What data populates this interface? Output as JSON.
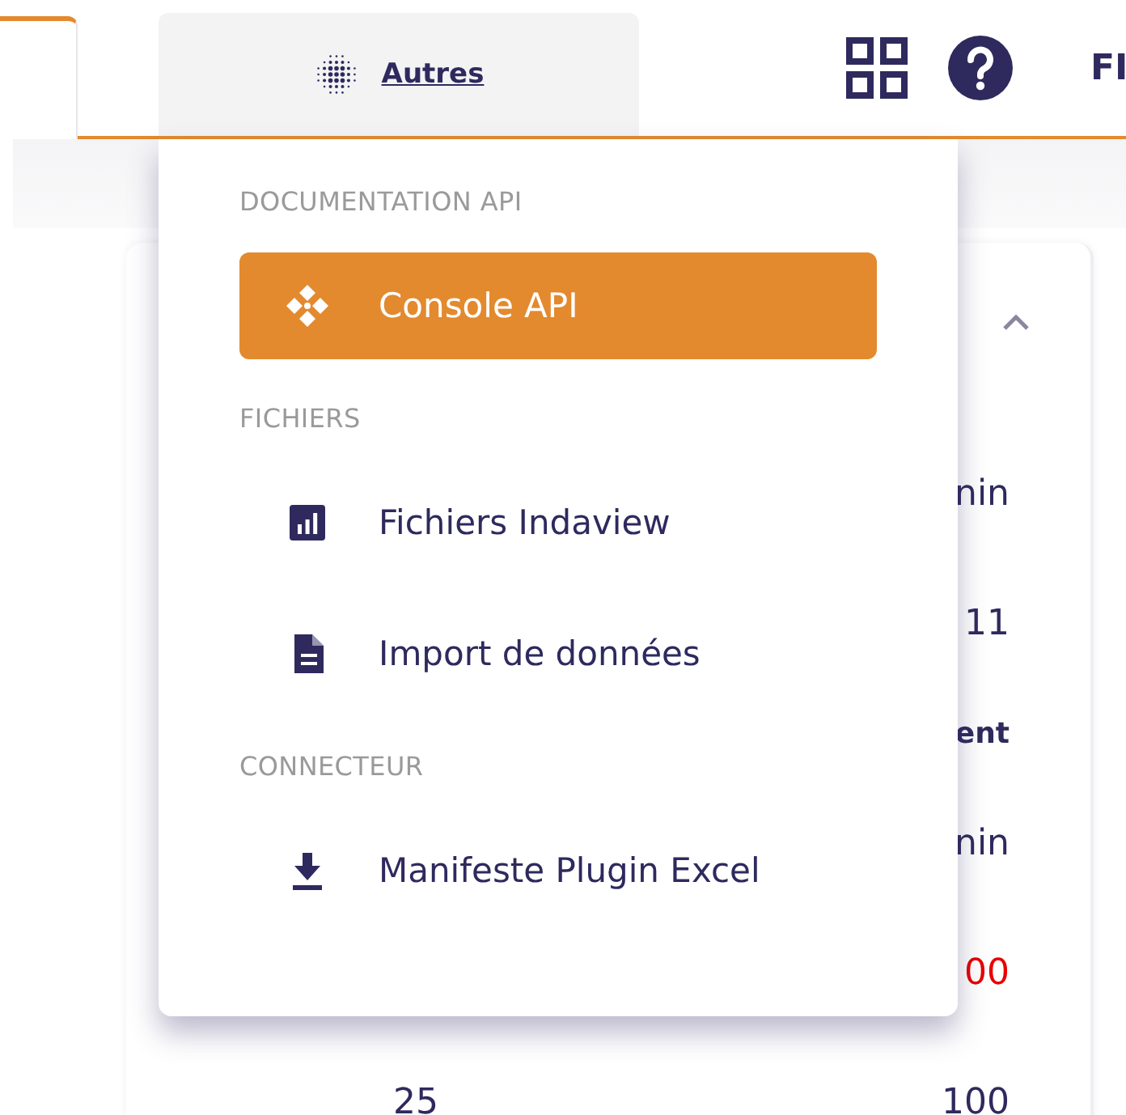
{
  "header": {
    "menu_tab": {
      "label": "Autres",
      "open": true
    },
    "user_menu": "FI"
  },
  "dropdown": {
    "open": true,
    "sections": [
      {
        "heading": "DOCUMENTATION API",
        "items": [
          {
            "label": "Console API",
            "kind": "api",
            "selected": true
          }
        ]
      },
      {
        "heading": "FICHIERS",
        "items": [
          {
            "label": "Fichiers Indaview",
            "kind": "chart",
            "selected": false
          },
          {
            "label": "Import de données",
            "kind": "document",
            "selected": false
          }
        ]
      },
      {
        "heading": "CONNECTEUR",
        "items": [
          {
            "label": "Manifeste Plugin Excel",
            "kind": "download",
            "selected": false
          }
        ]
      }
    ]
  },
  "card": {
    "expanded": true,
    "rows": [
      {
        "kind": "normal",
        "cells": [
          "nin"
        ]
      },
      {
        "kind": "normal",
        "cells": [
          "11"
        ]
      },
      {
        "kind": "heading",
        "cells": [
          "ent"
        ]
      },
      {
        "kind": "normal",
        "cells": [
          "nin"
        ]
      },
      {
        "kind": "alert",
        "cells": [
          "00"
        ]
      },
      {
        "kind": "normal",
        "cells": [
          "25",
          "100"
        ]
      }
    ]
  }
}
